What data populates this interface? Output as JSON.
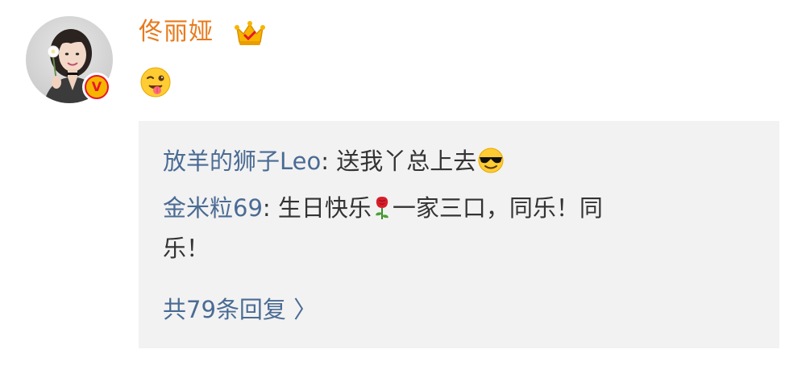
{
  "post": {
    "username": "佟丽娅",
    "crown_icon": "crown-icon",
    "verified_icon": "verified-v-badge-icon",
    "content_emoji": "wink-tongue-emoji"
  },
  "replies": [
    {
      "name": "放羊的狮子Leo",
      "separator": ": ",
      "text": "送我丫总上去",
      "emoji": "cool-sunglasses-emoji"
    },
    {
      "name": "金米粒69",
      "separator": ": ",
      "text_before": "生日快乐",
      "emoji": "rose-emoji",
      "text_after_line1": "一家三口，同乐！同",
      "text_line2": "乐！"
    }
  ],
  "more_replies": {
    "label": "共79条回复 〉"
  },
  "colors": {
    "username": "#e77a1e",
    "reply_name": "#4a6b94",
    "reply_text": "#333333",
    "reply_bg": "#f2f2f2",
    "badge_red": "#e6162d",
    "badge_gold": "#f7b500"
  }
}
